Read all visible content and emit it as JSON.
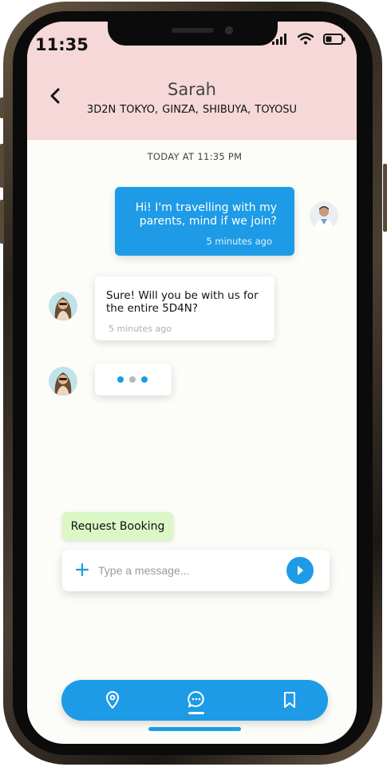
{
  "status_bar": {
    "time": "11:35"
  },
  "header": {
    "title": "Sarah",
    "subtitle": "3D2N  TOKYO, GINZA, SHIBUYA, TOYOSU"
  },
  "chat": {
    "date_label": "TODAY AT 11:35 PM",
    "messages": [
      {
        "direction": "outgoing",
        "lines": [
          "Hi! I'm travelling with my",
          "parents, mind if we join?"
        ],
        "time": "5 minutes ago"
      },
      {
        "direction": "incoming",
        "lines": [
          "Sure! Will you be with us for",
          "the entire 5D4N?"
        ],
        "time": "5 minutes ago"
      }
    ],
    "typing_indicator": true
  },
  "actions": {
    "request_booking_label": "Request Booking"
  },
  "composer": {
    "placeholder": "Type a message..."
  },
  "tabs": [
    {
      "icon": "location-pin-icon",
      "active": false
    },
    {
      "icon": "chat-bubble-icon",
      "active": true
    },
    {
      "icon": "bookmark-icon",
      "active": false
    }
  ],
  "colors": {
    "accent": "#1e9be6",
    "header_bg": "#f6d8d8",
    "booking_button": "#dcf7c6",
    "screen_bg": "#fcfcf8"
  }
}
